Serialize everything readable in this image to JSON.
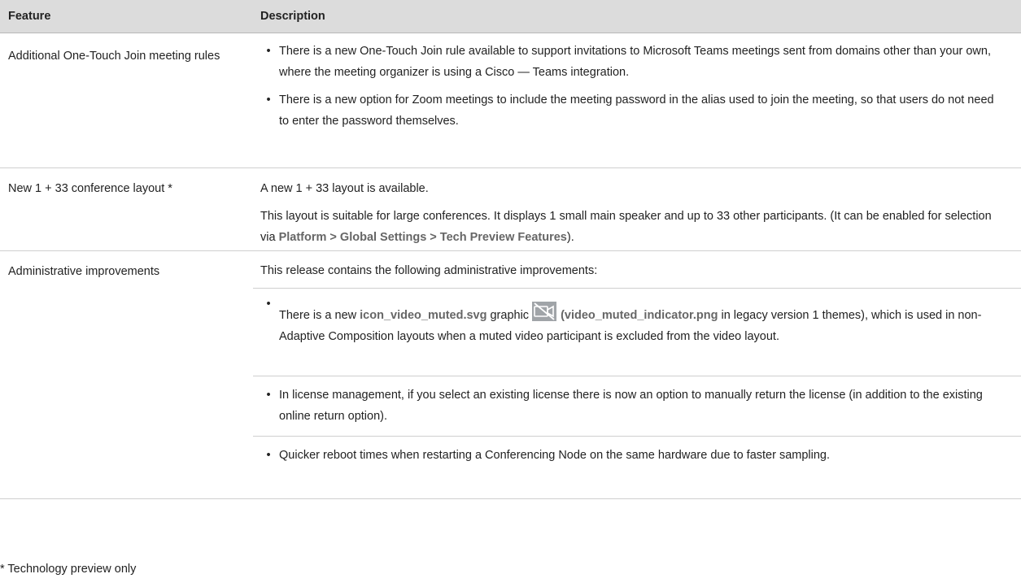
{
  "header": {
    "feature": "Feature",
    "description": "Description"
  },
  "rows": [
    {
      "feature": "Additional One-Touch Join meeting rules",
      "bullets": [
        "There is a new One-Touch Join rule available to support invitations to Microsoft Teams meetings sent from domains other than your own, where the meeting organizer is using a Cisco — Teams integration.",
        "There is a new option for Zoom meetings to include the meeting password in the alias used to join the meeting, so that users do not need to enter the password themselves."
      ]
    },
    {
      "feature": "New 1 + 33 conference layout *",
      "para1": "A new 1 + 33 layout is available.",
      "para2_prefix": "This layout is suitable for large conferences. It displays 1 small main speaker and up to 33 other participants. (It can be enabled for selection via ",
      "para2_path": "Platform > Global Settings > Tech Preview Features",
      "para2_suffix": ")."
    },
    {
      "feature": "Administrative improvements",
      "intro": "This release contains the following administrative improvements:",
      "b1_prefix": "There is a new ",
      "b1_file": "icon_video_muted.svg",
      "b1_mid": " graphic",
      "b1_paren_open": " (",
      "b1_legacy_file": "video_muted_indicator.png",
      "b1_suffix": " in legacy version 1 themes), which is used in non-Adaptive Composition layouts when a muted video participant is excluded from the video layout.",
      "b2": "In license management, if you select an existing license there is now an option to manually return the license (in addition to the existing online return option).",
      "b3": "Quicker reboot times when restarting a Conferencing Node on the same hardware due to faster sampling."
    }
  ],
  "footnote": "* Technology preview only",
  "icons": {
    "video_muted": "video-muted-icon"
  },
  "colors": {
    "header_bg": "#dcdcdc",
    "emphasis_text": "#666666",
    "icon_fill": "#a0a4a8"
  }
}
